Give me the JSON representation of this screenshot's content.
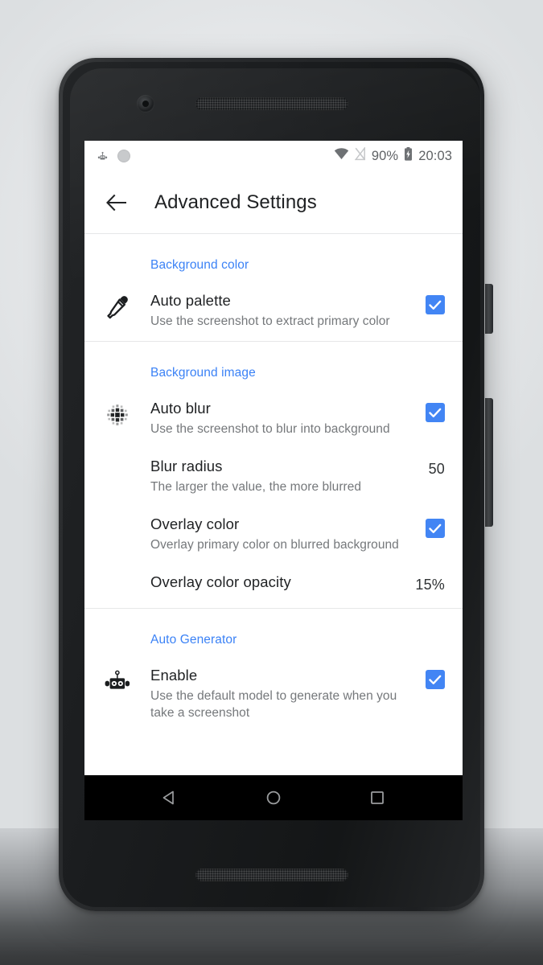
{
  "statusbar": {
    "left_icons": [
      {
        "name": "robot-notification-icon",
        "glyph": "robot"
      },
      {
        "name": "circle-notification-icon",
        "glyph": "circle"
      }
    ],
    "wifi_icon": "wifi-icon",
    "signal_off_icon": "signal-off-icon",
    "battery_percent": "90%",
    "battery_icon": "battery-charging-icon",
    "time": "20:03"
  },
  "appbar": {
    "back_icon": "arrow-left-icon",
    "title": "Advanced Settings"
  },
  "sections": [
    {
      "header": "Background color",
      "rows": [
        {
          "icon": "eyedropper-icon",
          "title": "Auto palette",
          "subtitle": "Use the screenshot to extract primary color",
          "control": "checkbox",
          "checked": true
        }
      ]
    },
    {
      "header": "Background image",
      "rows": [
        {
          "icon": "blur-dots-icon",
          "title": "Auto blur",
          "subtitle": "Use the screenshot to blur into background",
          "control": "checkbox",
          "checked": true
        },
        {
          "icon": "",
          "title": "Blur radius",
          "subtitle": "The larger the value, the more blurred",
          "control": "value",
          "value": "50"
        },
        {
          "icon": "",
          "title": "Overlay color",
          "subtitle": "Overlay primary color on blurred background",
          "control": "checkbox",
          "checked": true
        },
        {
          "icon": "",
          "title": "Overlay color opacity",
          "subtitle": "",
          "control": "value",
          "value": "15%"
        }
      ]
    },
    {
      "header": "Auto Generator",
      "rows": [
        {
          "icon": "robot-icon",
          "title": "Enable",
          "subtitle": "Use the default model to generate when you take a screenshot",
          "control": "checkbox",
          "checked": true
        }
      ]
    }
  ],
  "navbar": {
    "back": "nav-back-icon",
    "home": "nav-home-icon",
    "recents": "nav-recents-icon"
  },
  "colors": {
    "accent_blue": "#3b82f6",
    "checkbox_blue": "#4285f4",
    "title_text": "#1f2123",
    "subtitle_text": "#75787b"
  }
}
